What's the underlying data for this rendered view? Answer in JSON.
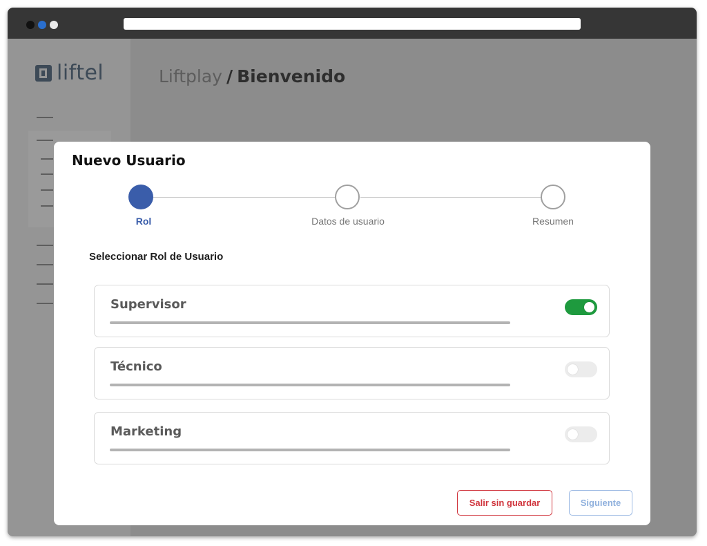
{
  "app": {
    "logo_text": "liftel",
    "breadcrumb": {
      "parent": "Liftplay",
      "separator": "/",
      "current": "Bienvenido"
    }
  },
  "modal": {
    "title": "Nuevo Usuario",
    "steps": [
      {
        "label": "Rol",
        "active": true
      },
      {
        "label": "Datos de usuario",
        "active": false
      },
      {
        "label": "Resumen",
        "active": false
      }
    ],
    "section_title": "Seleccionar Rol de Usuario",
    "roles": [
      {
        "name": "Supervisor",
        "enabled": true
      },
      {
        "name": "Técnico",
        "enabled": false
      },
      {
        "name": "Marketing",
        "enabled": false
      }
    ],
    "buttons": {
      "cancel": "Salir sin guardar",
      "next": "Siguiente"
    }
  },
  "colors": {
    "accent": "#3a5daa",
    "toggle_on": "#1e9a3e",
    "danger": "#d0343c",
    "next_button": "#8fb0dd"
  }
}
